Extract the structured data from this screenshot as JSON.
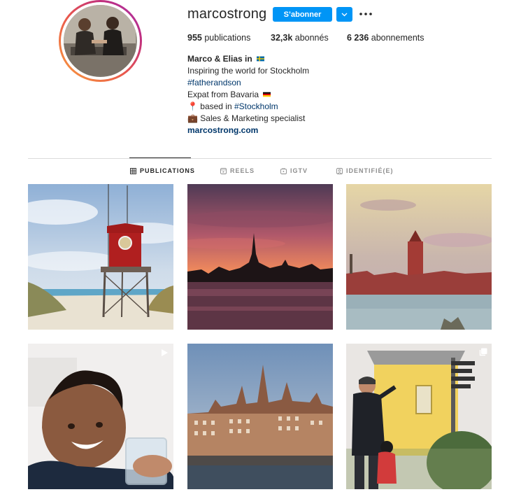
{
  "profile": {
    "username": "marcostrong",
    "follow_label": "S’abonner",
    "stats": {
      "posts_count": "955",
      "posts_label": " publications",
      "followers_count": "32,3k",
      "followers_label": " abonnés",
      "following_count": "6 236",
      "following_label": " abonnements"
    },
    "bio": {
      "name": "Marco & Elias in",
      "line1": "Inspiring the world for Stockholm",
      "hashtag1": "#fatherandson",
      "line3": "Expat from Bavaria",
      "line4_prefix": "📍 based in ",
      "hashtag2": "#Stockholm",
      "line5": "💼 Sales & Marketing specialist",
      "website": "marcostrong.com"
    }
  },
  "tabs": [
    {
      "label": "PUBLICATIONS",
      "icon": "grid-icon",
      "active": true
    },
    {
      "label": "REELS",
      "icon": "reels-icon",
      "active": false
    },
    {
      "label": "IGTV",
      "icon": "igtv-icon",
      "active": false
    },
    {
      "label": "IDENTIFIÉ(E)",
      "icon": "tagged-icon",
      "active": false
    }
  ],
  "posts": [
    {
      "subject": "lifeguard tower on beach",
      "badge": ""
    },
    {
      "subject": "Stockholm skyline at sunset",
      "badge": ""
    },
    {
      "subject": "Stockholm City Hall across water",
      "badge": ""
    },
    {
      "subject": "smiling boy with glass",
      "badge": "video-icon"
    },
    {
      "subject": "Stockholm old town buildings",
      "badge": ""
    },
    {
      "subject": "father and son at signpost",
      "badge": "carousel-icon"
    }
  ],
  "colors": {
    "accent": "#0095f6",
    "link": "#00376b",
    "text": "#262626",
    "muted": "#8e8e8e",
    "divider": "#dbdbdb"
  }
}
